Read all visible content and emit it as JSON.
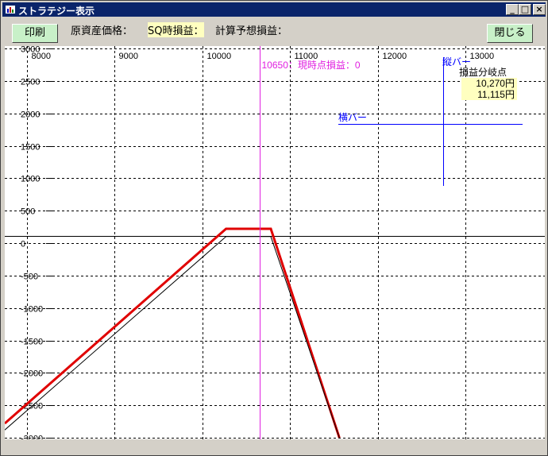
{
  "window": {
    "title": "ストラテジー表示",
    "minimize_label": "_",
    "maximize_label": "□",
    "close_label": "×"
  },
  "toolbar": {
    "print_label": "印刷",
    "underlying_price_label": "原資産価格：",
    "sq_pnl_label": "SQ時損益：",
    "calc_expected_pnl_label": "計算予想損益：",
    "close_label": "閉じる"
  },
  "chart_data": {
    "type": "line",
    "x_ticks": [
      8000,
      9000,
      10000,
      11000,
      12000,
      13000
    ],
    "y_ticks": [
      3000,
      2500,
      2000,
      1500,
      1000,
      500,
      0,
      -500,
      -1000,
      -1500,
      -2000,
      -2500,
      -3000
    ],
    "xlim": [
      7750,
      13900
    ],
    "ylim": [
      -3000,
      3000
    ],
    "grid": true,
    "series": [
      {
        "color": "#e00000",
        "points": [
          [
            7750,
            -2780
          ],
          [
            10270,
            220
          ],
          [
            10780,
            220
          ],
          [
            11560,
            -3000
          ]
        ]
      },
      {
        "color": "#000000",
        "points": [
          [
            7750,
            -2880
          ],
          [
            10270,
            100
          ],
          [
            10780,
            100
          ],
          [
            11560,
            -3000
          ]
        ]
      }
    ],
    "current_price_line": {
      "x": 10650,
      "color": "#e020e0",
      "label": "10650：現時点損益：0"
    },
    "vertical_bar": {
      "label": "縦バー",
      "color": "#0000ff"
    },
    "horizontal_bar": {
      "label": "横バー",
      "color": "#0000ff"
    },
    "breakeven": {
      "title": "損益分岐点",
      "values": [
        "10,270円",
        "11,115円"
      ]
    }
  }
}
